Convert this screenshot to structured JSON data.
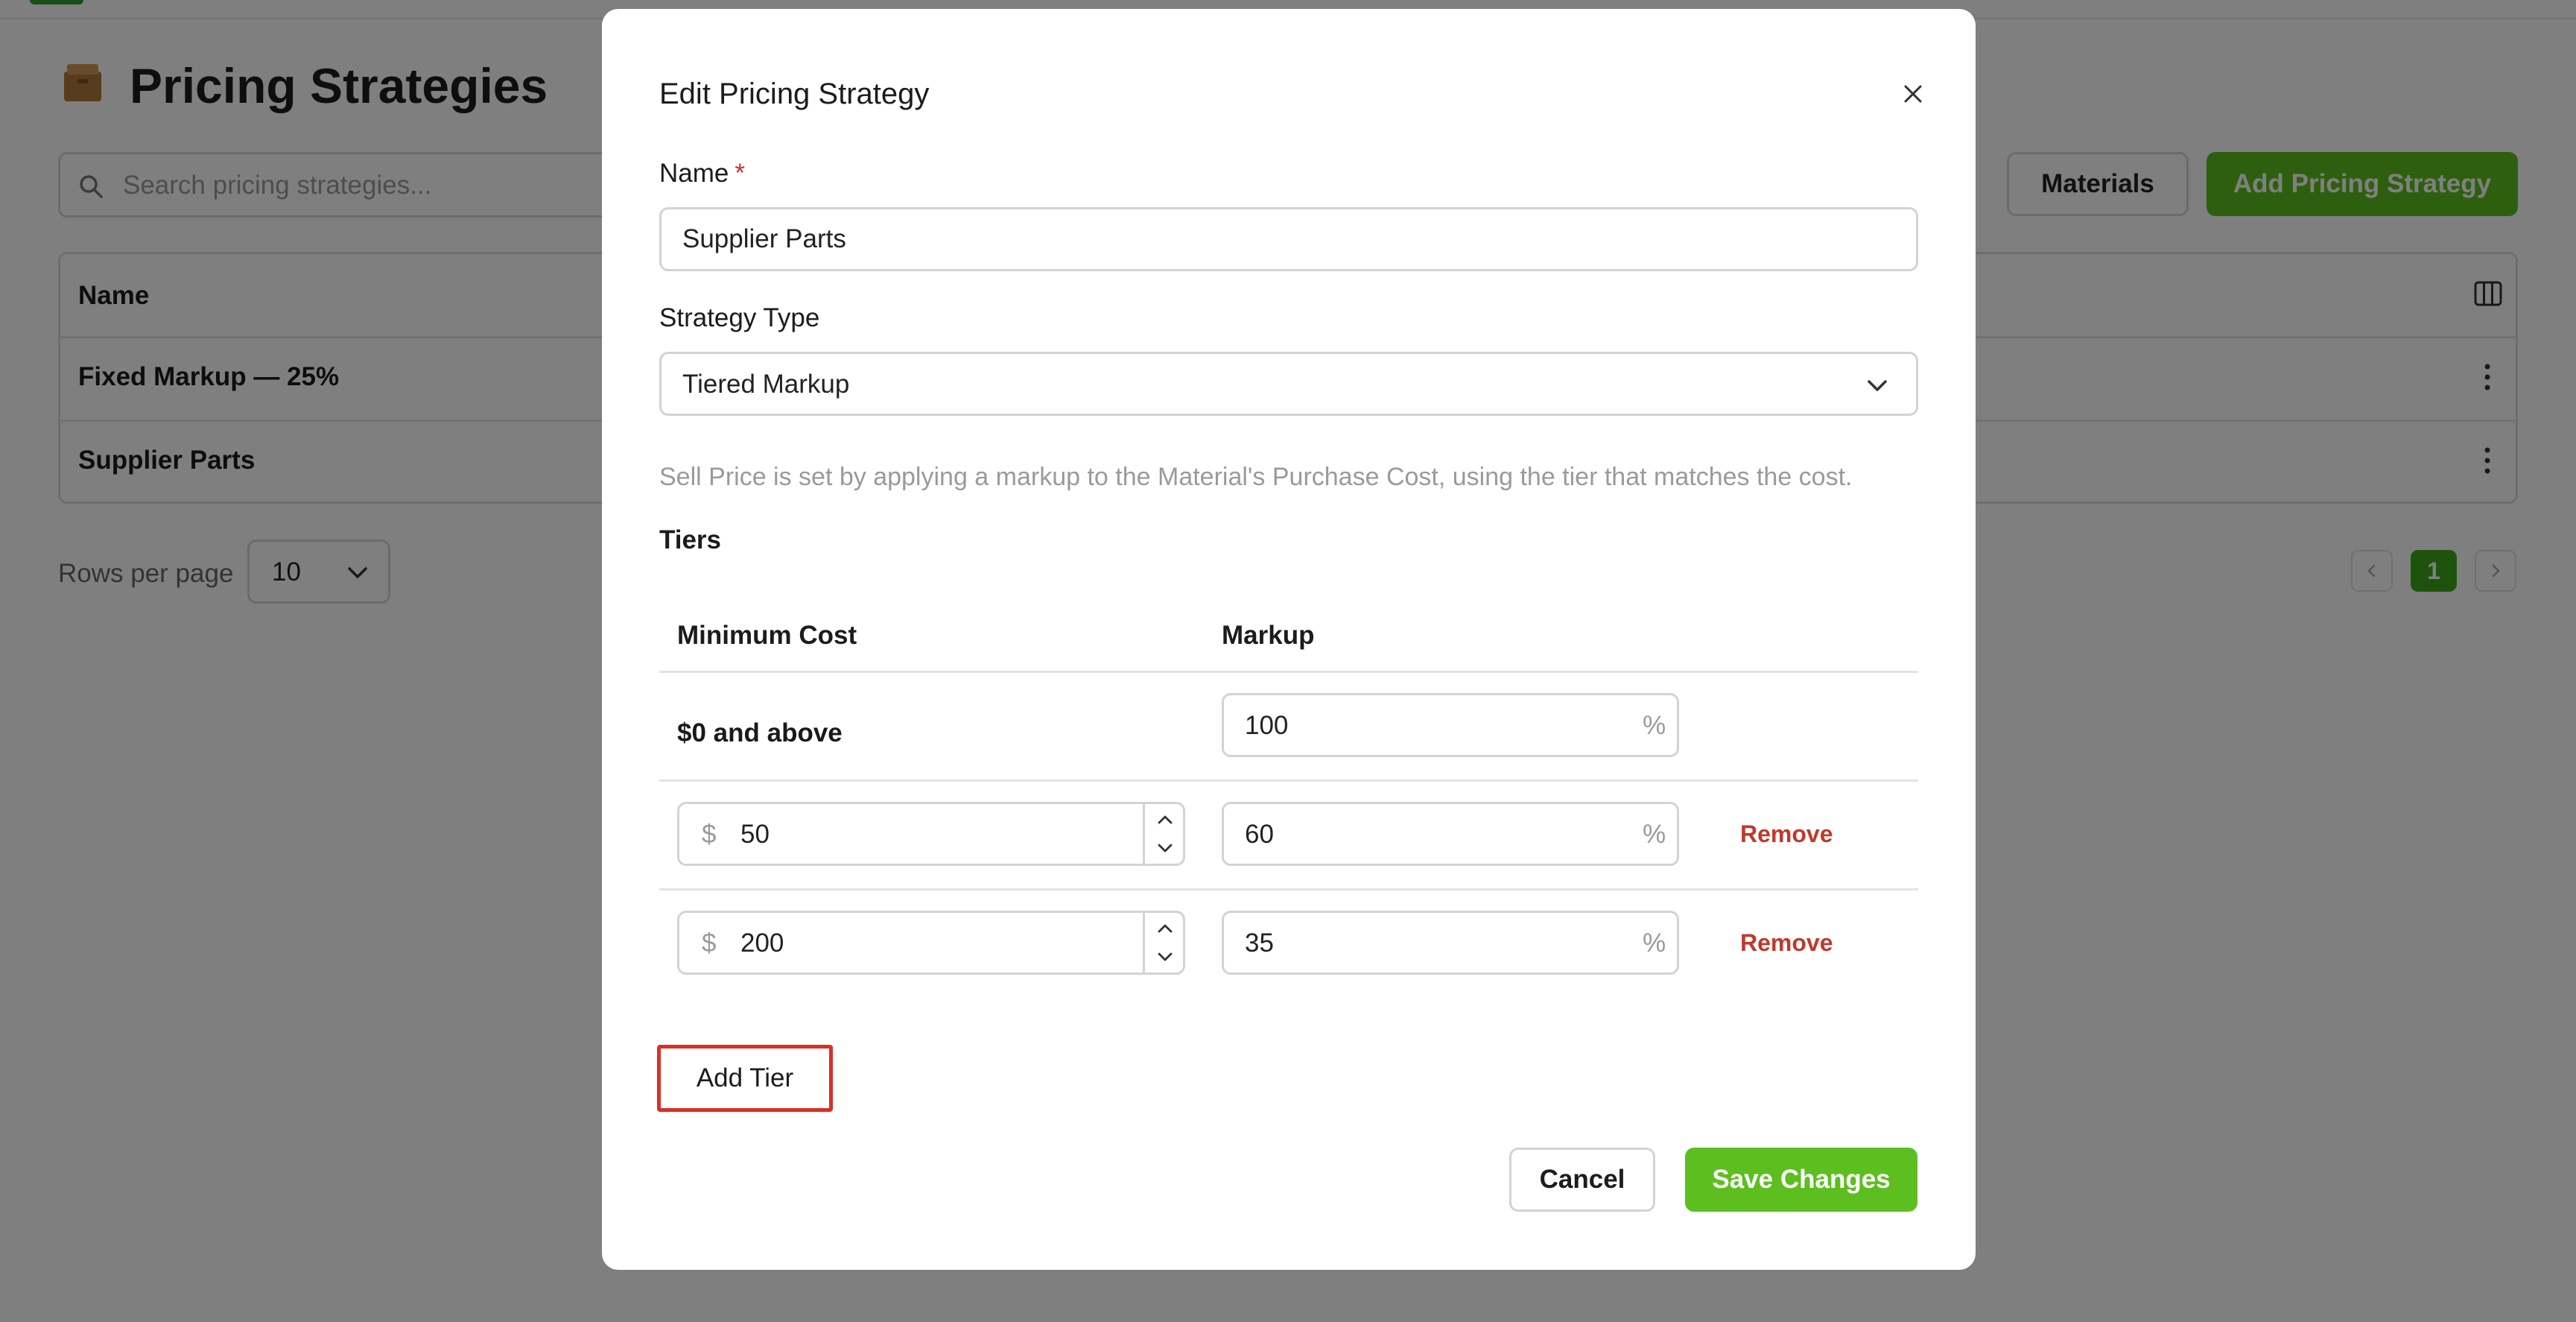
{
  "page": {
    "title": "Pricing Strategies",
    "search_placeholder": "Search pricing strategies...",
    "materials_label": "Materials",
    "add_label": "Add Pricing Strategy",
    "table": {
      "name_header": "Name",
      "rows": [
        "Fixed Markup — 25%",
        "Supplier Parts"
      ]
    },
    "rows_per_page_label": "Rows per page",
    "rows_per_page_value": "10",
    "current_page": "1"
  },
  "modal": {
    "title": "Edit Pricing Strategy",
    "name_label": "Name",
    "required_mark": "*",
    "name_value": "Supplier Parts",
    "type_label": "Strategy Type",
    "type_value": "Tiered Markup",
    "description": "Sell Price is set by applying a markup to the Material's Purchase Cost, using the tier that matches the cost.",
    "tiers_label": "Tiers",
    "col_min_cost": "Minimum Cost",
    "col_markup": "Markup",
    "base_tier_label": "$0 and above",
    "base_tier_markup": "100",
    "currency_symbol": "$",
    "percent_symbol": "%",
    "tiers": [
      {
        "min_cost": "50",
        "markup": "60",
        "remove_label": "Remove"
      },
      {
        "min_cost": "200",
        "markup": "35",
        "remove_label": "Remove"
      }
    ],
    "add_tier_label": "Add Tier",
    "cancel_label": "Cancel",
    "save_label": "Save Changes"
  },
  "colors": {
    "accent_green": "#5cbf1f",
    "danger_red": "#c0392b",
    "highlight_red": "#d93025"
  }
}
